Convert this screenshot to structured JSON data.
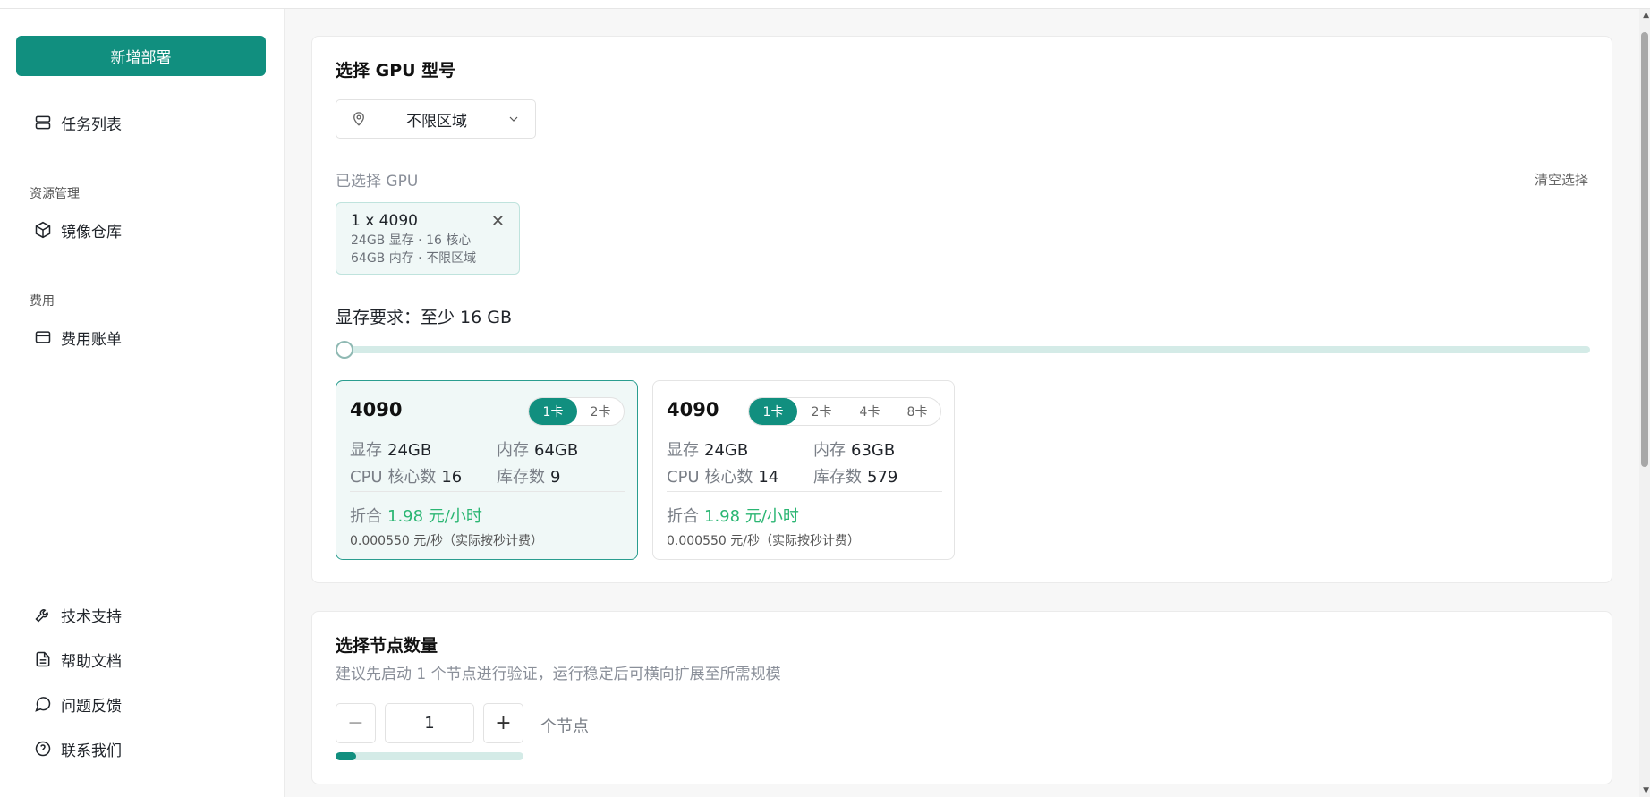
{
  "sidebar": {
    "new_deploy": "新增部署",
    "task_list": "任务列表",
    "section_resources": "资源管理",
    "image_repo": "镜像仓库",
    "section_billing": "费用",
    "billing": "费用账单",
    "tech_support": "技术支持",
    "help_docs": "帮助文档",
    "feedback": "问题反馈",
    "contact": "联系我们"
  },
  "gpu_panel": {
    "title": "选择 GPU 型号",
    "region": "不限区域",
    "selected_label": "已选择 GPU",
    "clear": "清空选择",
    "chip": {
      "title": "1 x 4090",
      "line1": "24GB 显存 · 16 核心",
      "line2": "64GB 内存 · 不限区域"
    },
    "vram_req": "显存要求：至少 16 GB",
    "vram_slider": {
      "min": 16,
      "value": 16
    },
    "cards": [
      {
        "name": "4090",
        "options": [
          "1卡",
          "2卡"
        ],
        "selected_option": "1卡",
        "vram_label": "显存",
        "vram": "24GB",
        "mem_label": "内存",
        "mem": "64GB",
        "cpu_label": "CPU 核心数",
        "cpu": "16",
        "stock_label": "库存数",
        "stock": "9",
        "price_label": "折合",
        "price": "1.98 元/小时",
        "price_sec": "0.000550 元/秒（实际按秒计费）"
      },
      {
        "name": "4090",
        "options": [
          "1卡",
          "2卡",
          "4卡",
          "8卡"
        ],
        "selected_option": "1卡",
        "vram_label": "显存",
        "vram": "24GB",
        "mem_label": "内存",
        "mem": "63GB",
        "cpu_label": "CPU 核心数",
        "cpu": "14",
        "stock_label": "库存数",
        "stock": "579",
        "price_label": "折合",
        "price": "1.98 元/小时",
        "price_sec": "0.000550 元/秒（实际按秒计费）"
      }
    ]
  },
  "node_panel": {
    "title": "选择节点数量",
    "hint": "建议先启动 1 个节点进行验证，运行稳定后可横向扩展至所需规模",
    "minus": "−",
    "value": "1",
    "plus": "+",
    "unit": "个节点",
    "progress_fraction": 0.11
  },
  "colors": {
    "accent": "#118f7f",
    "price_green": "#2bb673",
    "track": "#d4ebe7"
  }
}
